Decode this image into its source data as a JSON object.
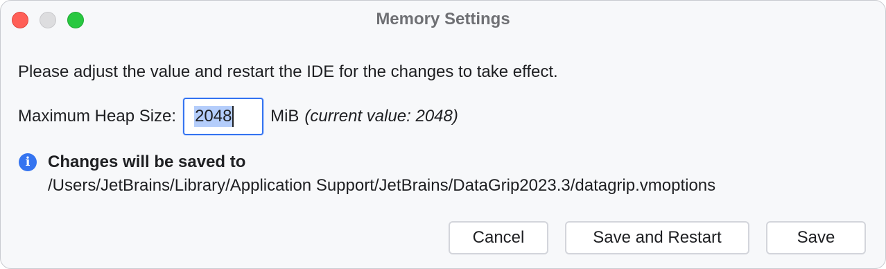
{
  "window": {
    "title": "Memory Settings"
  },
  "dialog": {
    "message": "Please adjust the value and restart the IDE for the changes to take effect.",
    "heap": {
      "label": "Maximum Heap Size:",
      "value": "2048",
      "unit": "MiB",
      "current_value_text": "(current value: 2048)"
    },
    "info": {
      "icon": "info-icon",
      "heading": "Changes will be saved to",
      "path": "/Users/JetBrains/Library/Application Support/JetBrains/DataGrip2023.3/datagrip.vmoptions"
    }
  },
  "buttons": {
    "cancel": "Cancel",
    "save_and_restart": "Save and Restart",
    "save": "Save"
  },
  "colors": {
    "accent": "#3574f0",
    "selection": "#b4cdfb",
    "close": "#ff5f57",
    "zoom": "#28c840"
  }
}
